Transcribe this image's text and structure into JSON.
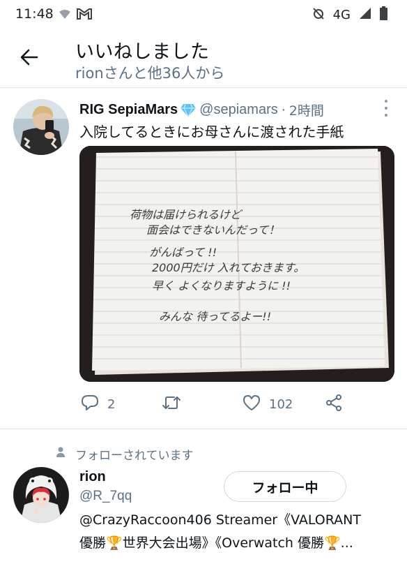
{
  "status_bar": {
    "time": "11:48",
    "network": "4G"
  },
  "header": {
    "title": "いいねしました",
    "subtitle": "rionさんと他36人から",
    "back_icon": "arrow-left-icon"
  },
  "tweet": {
    "author_name": "RIG SepiaMars",
    "badge": "💎",
    "handle": "@sepiamars",
    "separator": "·",
    "time": "2時間",
    "text": "入院してるときにお母さんに渡された手紙",
    "letter_lines": [
      "荷物は届けられるけど",
      "面会はできないんだって！",
      "がんばって !!",
      "2000円だけ 入れておきます。",
      "早く よくなりますように !!",
      "みんな 待ってるよー!!"
    ],
    "actions": {
      "replies": "2",
      "retweets": "",
      "likes": "102"
    }
  },
  "follow_context": "フォローされています",
  "user": {
    "name": "rion",
    "handle": "@R_7qq",
    "follow_button": "フォロー中",
    "bio_line1": "@CrazyRaccoon406 Streamer《VALORANT",
    "bio_line2": "優勝🏆世界大会出場》《Overwatch 優勝🏆..."
  },
  "colors": {
    "accent": "#1da1f2",
    "secondary_text": "#5b7083",
    "primary_text": "#0f1419",
    "divider": "#e6e9ec"
  }
}
